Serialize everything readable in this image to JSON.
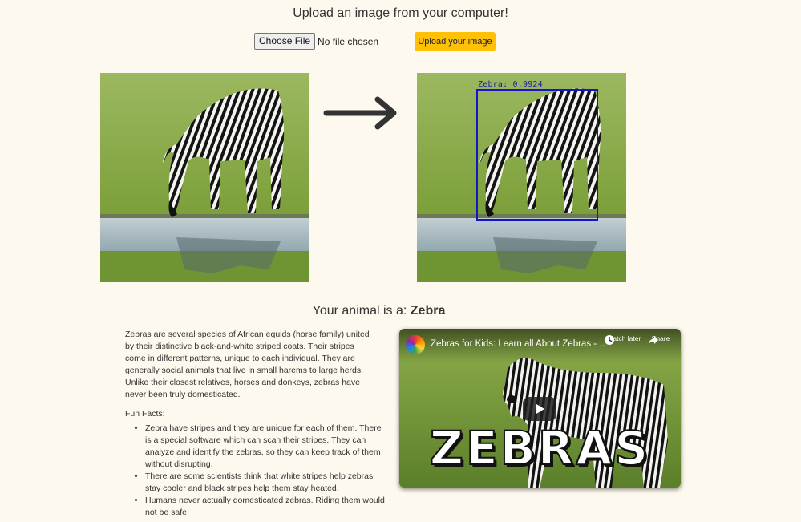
{
  "header": {
    "title": "Upload an image from your computer!"
  },
  "upload": {
    "choose_file_label": "Choose File",
    "file_status": "No file chosen",
    "submit_label": "Upload your image",
    "submit_color": "#fec107"
  },
  "images": {
    "input_alt": "zebra-input-photo",
    "output_alt": "zebra-detected-photo"
  },
  "detection": {
    "label": "Zebra: 0.9924",
    "box_color": "#1414c8"
  },
  "result": {
    "prefix": "Your animal is a:",
    "animal": "Zebra"
  },
  "description": "Zebras are several species of African equids (horse family) united by their distinctive black-and-white striped coats. Their stripes come in different patterns, unique to each individual. They are generally social animals that live in small harems to large herds. Unlike their closest relatives, horses and donkeys, zebras have never been truly domesticated.",
  "fun_facts": {
    "title": "Fun Facts:",
    "items": [
      "Zebra have stripes and they are unique for each of them. There is a special software which can scan their stripes. They can analyze and identify the zebras, so they can keep track of them without disrupting.",
      "There are some scientists think that white stripes help zebras stay cooler and black stripes help them stay heated.",
      "Humans never actually domesticated zebras. Riding them would not be safe."
    ]
  },
  "video": {
    "title": "Zebras for Kids: Learn all About Zebras - ...",
    "watch_later": "Watch later",
    "share": "Share",
    "thumbnail_text": "ZEBRAS",
    "icons": [
      "clock-icon",
      "share-icon",
      "play-icon"
    ]
  }
}
